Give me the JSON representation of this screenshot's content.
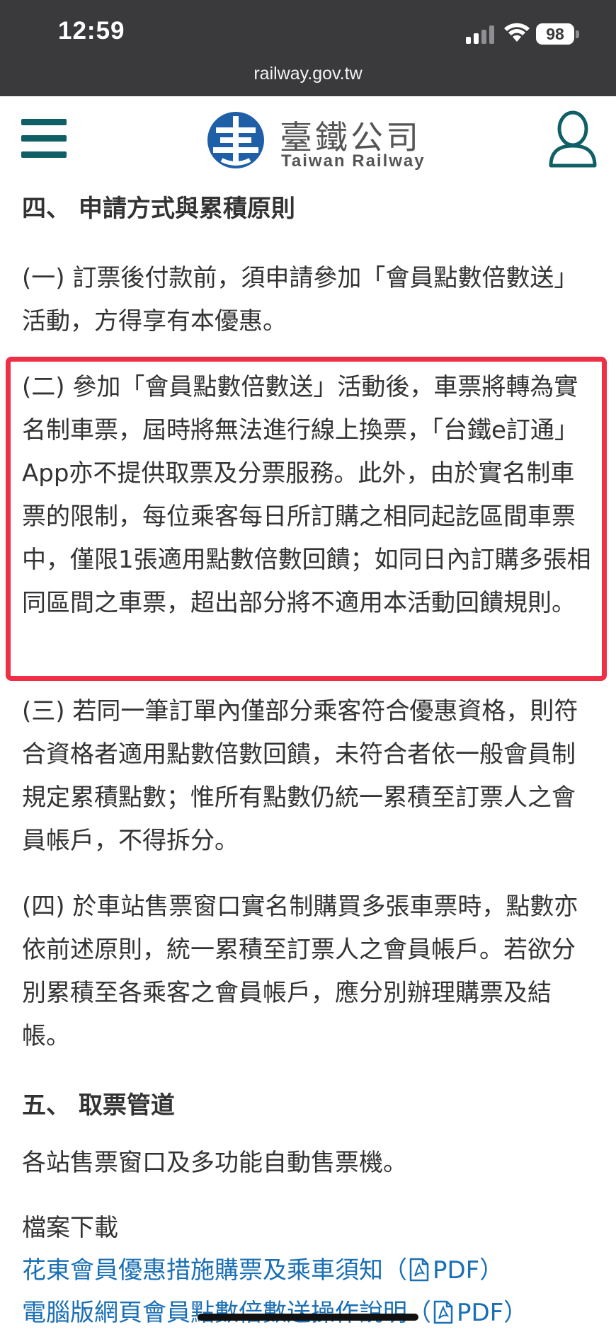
{
  "status_bar": {
    "time": "12:59",
    "battery": "98"
  },
  "browser": {
    "url": "railway.gov.tw"
  },
  "site": {
    "name_zh": "臺鐵公司",
    "name_en": "Taiwan Railway"
  },
  "section4": {
    "heading": "四、 申請方式與累積原則",
    "items": [
      "(一) 訂票後付款前，須申請參加「會員點數倍數送」活動，方得享有本優惠。",
      "(二) 參加「會員點數倍數送」活動後，車票將轉為實名制車票，屆時將無法進行線上換票，「台鐵e訂通」App亦不提供取票及分票服務。此外，由於實名制車票的限制，每位乘客每日所訂購之相同起訖區間車票中，僅限1張適用點數倍數回饋；如同日內訂購多張相同區間之車票，超出部分將不適用本活動回饋規則。",
      "(三) 若同一筆訂單內僅部分乘客符合優惠資格，則符合資格者適用點數倍數回饋，未符合者依一般會員制規定累積點數；惟所有點數仍統一累積至訂票人之會員帳戶，不得拆分。",
      "(四) 於車站售票窗口實名制購買多張車票時，點數亦依前述原則，統一累積至訂票人之會員帳戶。若欲分別累積至各乘客之會員帳戶，應分別辦理購票及結帳。"
    ]
  },
  "section5": {
    "heading": "五、 取票管道",
    "text": "各站售票窗口及多功能自動售票機。"
  },
  "downloads": {
    "label": "檔案下載",
    "links": [
      {
        "text": "花東會員優惠措施購票及乘車須知（",
        "type": "PDF",
        "close": "）"
      },
      {
        "text": "電腦版網頁會員點數倍數送操作說明（",
        "type": "PDF",
        "close": "）"
      }
    ]
  },
  "colors": {
    "highlight_border": "#ee2f45",
    "brand_teal": "#115f66",
    "link": "#1a6fb5",
    "logo_blue": "#1f5fa8"
  }
}
